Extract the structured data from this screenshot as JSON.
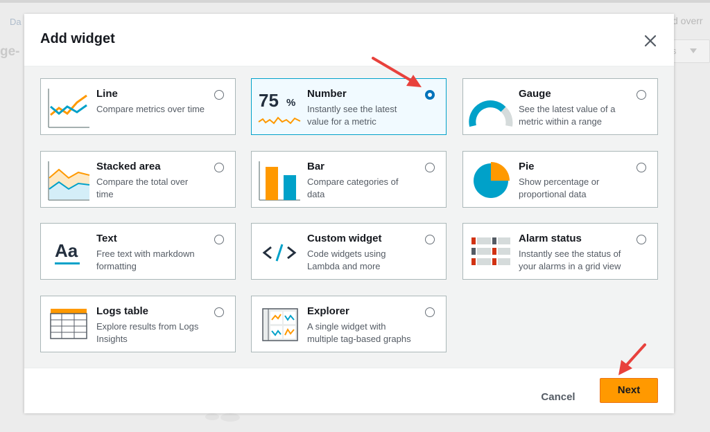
{
  "background": {
    "crumb_left": "Da",
    "crumb_right": "d overr",
    "title_left": "ge-",
    "dropdown_text": "s"
  },
  "modal": {
    "title": "Add widget",
    "close_icon": "close-icon"
  },
  "widgets": [
    {
      "id": "line",
      "title": "Line",
      "desc": "Compare metrics over time",
      "icon": "line-chart-icon",
      "selected": false
    },
    {
      "id": "number",
      "title": "Number",
      "desc": "Instantly see the latest value for a metric",
      "icon": "number-icon",
      "icon_text": "75",
      "icon_unit": "%",
      "selected": true
    },
    {
      "id": "gauge",
      "title": "Gauge",
      "desc": "See the latest value of a metric within a range",
      "icon": "gauge-icon",
      "selected": false
    },
    {
      "id": "stacked-area",
      "title": "Stacked area",
      "desc": "Compare the total over time",
      "icon": "stacked-area-icon",
      "selected": false
    },
    {
      "id": "bar",
      "title": "Bar",
      "desc": "Compare categories of data",
      "icon": "bar-chart-icon",
      "selected": false
    },
    {
      "id": "pie",
      "title": "Pie",
      "desc": "Show percentage or proportional data",
      "icon": "pie-chart-icon",
      "selected": false
    },
    {
      "id": "text",
      "title": "Text",
      "desc": "Free text with markdown formatting",
      "icon": "text-icon",
      "icon_text": "Aa",
      "selected": false
    },
    {
      "id": "custom-widget",
      "title": "Custom widget",
      "desc": "Code widgets using Lambda and more",
      "icon": "code-icon",
      "icon_text": "</>",
      "selected": false
    },
    {
      "id": "alarm-status",
      "title": "Alarm status",
      "desc": "Instantly see the status of your alarms in a grid view",
      "icon": "alarm-grid-icon",
      "selected": false
    },
    {
      "id": "logs-table",
      "title": "Logs table",
      "desc": "Explore results from Logs Insights",
      "icon": "table-icon",
      "selected": false
    },
    {
      "id": "explorer",
      "title": "Explorer",
      "desc": "A single widget with multiple tag-based graphs",
      "icon": "explorer-icon",
      "selected": false
    }
  ],
  "footer": {
    "cancel_label": "Cancel",
    "next_label": "Next"
  },
  "colors": {
    "accent_orange": "#ff9900",
    "accent_blue": "#00a1c9",
    "selected_radio": "#0073bb",
    "annotation_arrow": "#e8413c"
  }
}
